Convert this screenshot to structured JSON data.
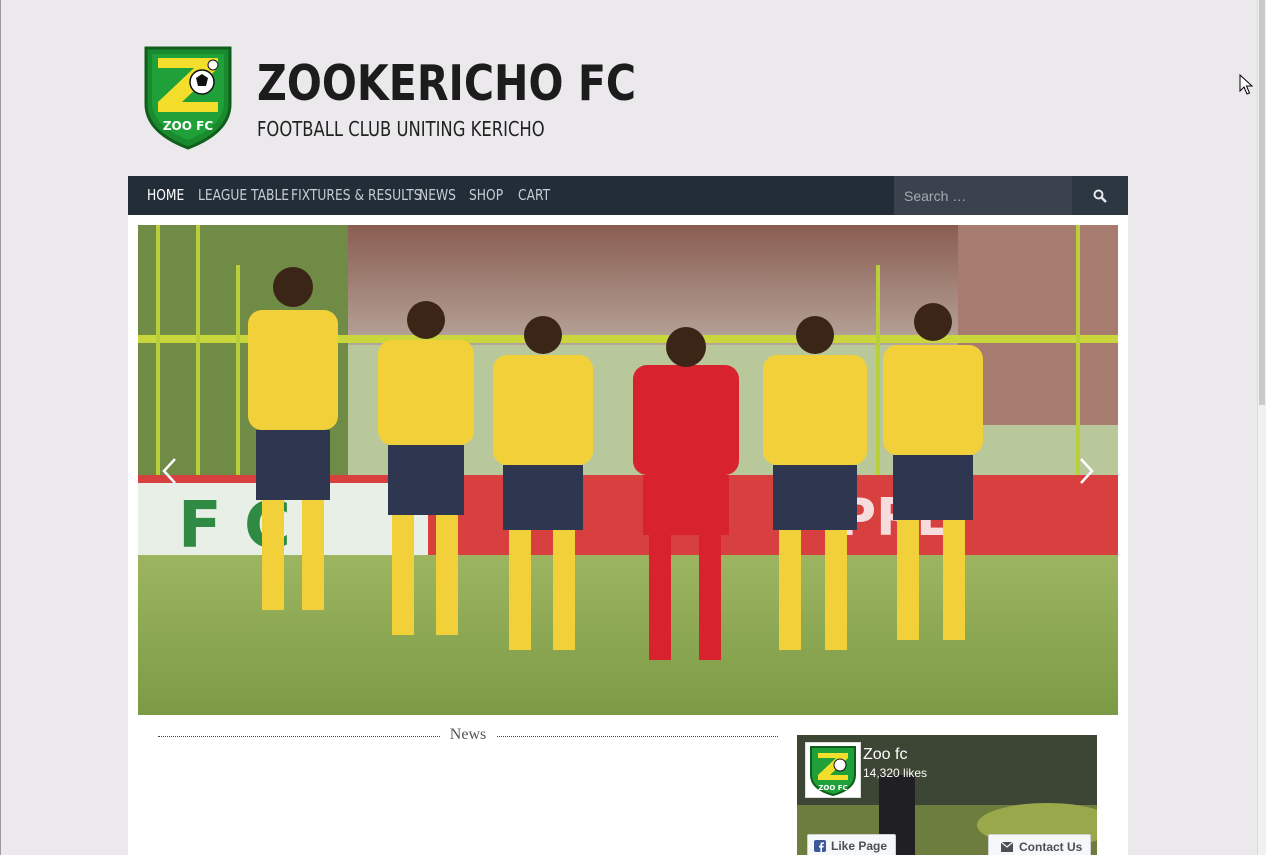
{
  "site": {
    "title": "ZOOKERICHO FC",
    "tagline": "FOOTBALL CLUB UNITING KERICHO",
    "logo_text": "ZOO FC"
  },
  "nav": {
    "items": [
      {
        "label": "HOME",
        "active": true
      },
      {
        "label": "LEAGUE TABLE",
        "active": false
      },
      {
        "label": "FIXTURES & RESULTS",
        "active": false
      },
      {
        "label": "NEWS",
        "active": false
      },
      {
        "label": "SHOP",
        "active": false
      },
      {
        "label": "CART",
        "active": false
      }
    ],
    "search_placeholder": "Search …"
  },
  "slider": {
    "prev_icon": "chevron-left-icon",
    "next_icon": "chevron-right-icon",
    "image": "team-photo"
  },
  "news": {
    "heading": "News"
  },
  "facebook_widget": {
    "page_name": "Zoo fc",
    "likes": "14,320 likes",
    "like_button": "Like Page",
    "contact_button": "Contact Us"
  },
  "colors": {
    "page_bg": "#ebe9ec",
    "nav_bg": "#232d38",
    "kit_yellow": "#f2d03a",
    "kit_navy": "#2f3650",
    "logo_green": "#1a8a2e"
  }
}
